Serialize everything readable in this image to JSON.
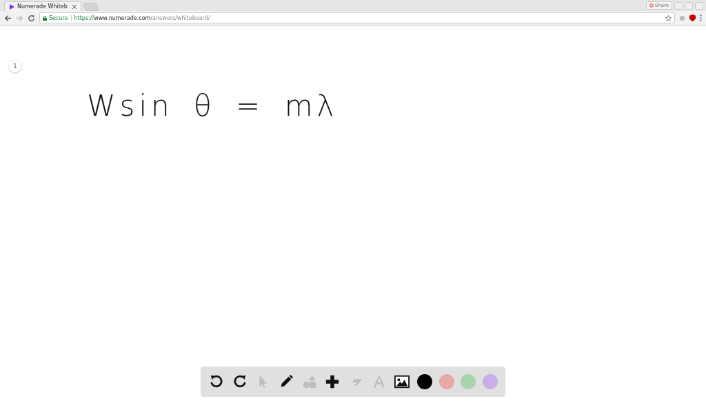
{
  "browser": {
    "tab_title": "Numerade Whiteb",
    "share_label": "Share",
    "secure_label": "Secure",
    "url_scheme": "https://",
    "url_host": "www.numerade.com",
    "url_path": "/answers/whiteboard/"
  },
  "whiteboard": {
    "page_number": "1",
    "ink": "Wsin θ = mλ"
  },
  "toolbar": {
    "tools": [
      {
        "kind": "undo",
        "disabled": false
      },
      {
        "kind": "redo",
        "disabled": false
      },
      {
        "kind": "select",
        "disabled": true
      },
      {
        "kind": "pen",
        "disabled": false
      },
      {
        "kind": "shapes",
        "disabled": true
      },
      {
        "kind": "add",
        "disabled": false
      },
      {
        "kind": "eraser",
        "disabled": true
      },
      {
        "kind": "text",
        "disabled": true
      },
      {
        "kind": "image",
        "disabled": false
      }
    ],
    "colors": [
      {
        "color": "#000000"
      },
      {
        "color": "#e8a8a8"
      },
      {
        "color": "#a8d4ad"
      },
      {
        "color": "#c9aee8"
      }
    ]
  }
}
